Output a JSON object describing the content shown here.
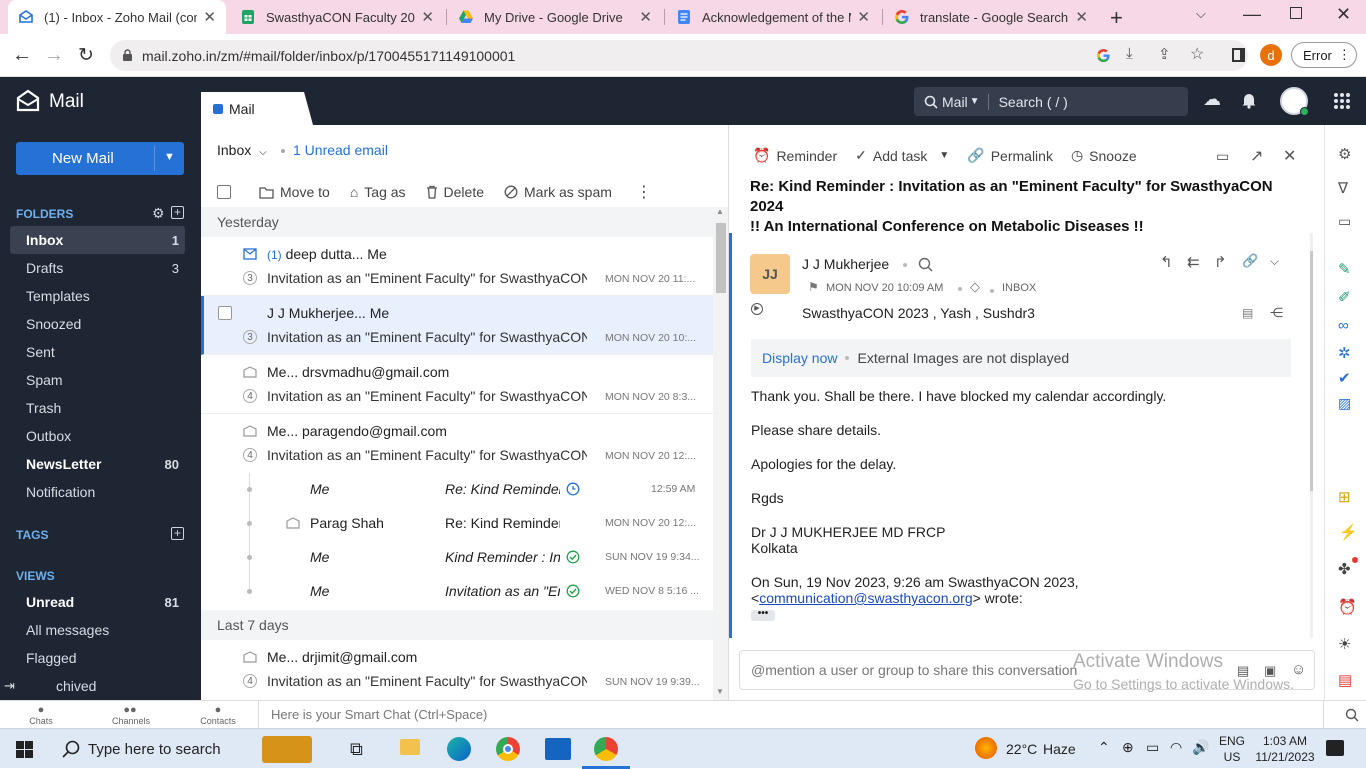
{
  "browser": {
    "tabs": [
      {
        "title": "(1) - Inbox - Zoho Mail (com",
        "active": true,
        "icon": "zoho-mail-icon"
      },
      {
        "title": "SwasthyaCON Faculty 2024",
        "active": false,
        "icon": "sheets-icon"
      },
      {
        "title": "My Drive - Google Drive",
        "active": false,
        "icon": "drive-icon"
      },
      {
        "title": "Acknowledgement of the M",
        "active": false,
        "icon": "docs-icon"
      },
      {
        "title": "translate - Google Search",
        "active": false,
        "icon": "google-icon"
      }
    ],
    "url": "mail.zoho.in/zm/#mail/folder/inbox/p/1700455171149100001",
    "profile_letter": "d",
    "error_label": "Error"
  },
  "app": {
    "name": "Mail",
    "tab_label": "Mail",
    "search_scope": "Mail",
    "search_placeholder": "Search ( / )"
  },
  "sidebar": {
    "new_mail": "New Mail",
    "folders_heading": "FOLDERS",
    "folders": [
      {
        "label": "Inbox",
        "count": "1",
        "active": true
      },
      {
        "label": "Drafts",
        "count": "3"
      },
      {
        "label": "Templates",
        "count": ""
      },
      {
        "label": "Snoozed",
        "count": ""
      },
      {
        "label": "Sent",
        "count": ""
      },
      {
        "label": "Spam",
        "count": ""
      },
      {
        "label": "Trash",
        "count": ""
      },
      {
        "label": "Outbox",
        "count": ""
      },
      {
        "label": "NewsLetter",
        "count": "80",
        "bold": true
      },
      {
        "label": "Notification",
        "count": ""
      }
    ],
    "tags_heading": "TAGS",
    "views_heading": "VIEWS",
    "views": [
      {
        "label": "Unread",
        "count": "81",
        "bold": true
      },
      {
        "label": "All messages",
        "count": ""
      },
      {
        "label": "Flagged",
        "count": ""
      },
      {
        "label": "chived",
        "count": ""
      }
    ]
  },
  "list": {
    "folder": "Inbox",
    "unread": "1 Unread email",
    "toolbar": {
      "move": "Move to",
      "tag": "Tag as",
      "delete": "Delete",
      "spam": "Mark as spam"
    },
    "group_yesterday": "Yesterday",
    "group_last7": "Last 7 days",
    "rows": [
      {
        "prefix": "(1)",
        "from": "deep dutta... Me",
        "count": "3",
        "subject": "Invitation as an \"Eminent Faculty\" for SwasthyaCON 2024",
        "date": "MON NOV 20 11:..."
      },
      {
        "prefix": "",
        "from": "J J Mukherjee... Me",
        "count": "3",
        "subject": "Invitation as an \"Eminent Faculty\" for SwasthyaCON 2024",
        "date": "MON NOV 20 10:..."
      },
      {
        "prefix": "",
        "from": "Me... drsvmadhu@gmail.com",
        "count": "4",
        "subject": "Invitation as an \"Eminent Faculty\" for SwasthyaCON 2024",
        "date": "MON NOV 20 8:3..."
      },
      {
        "prefix": "",
        "from": "Me... paragendo@gmail.com",
        "count": "4",
        "subject": "Invitation as an \"Eminent Faculty\" for SwasthyaCON 2024",
        "date": "MON NOV 20 12:..."
      }
    ],
    "thread": [
      {
        "from": "Me",
        "subject": "Re: Kind Reminder : Invitation",
        "date": "12:59 AM",
        "status": "clock"
      },
      {
        "from": "Parag Shah",
        "subject": "Re: Kind Reminder : Invitation",
        "date": "MON NOV 20 12:...",
        "status": ""
      },
      {
        "from": "Me",
        "subject": "Kind Reminder : Invitation",
        "date": "SUN NOV 19 9:34...",
        "status": "check"
      },
      {
        "from": "Me",
        "subject": "Invitation as an \"Eminent",
        "date": "WED NOV 8 5:16 ...",
        "status": "check"
      }
    ],
    "last_row": {
      "from": "Me... drjimit@gmail.com",
      "count": "4",
      "subject": "Invitation as an \"Eminent Faculty\" for SwasthyaCON 2024",
      "date": "SUN NOV 19 9:39..."
    }
  },
  "reader": {
    "toolbar": {
      "reminder": "Reminder",
      "add_task": "Add task",
      "permalink": "Permalink",
      "snooze": "Snooze"
    },
    "subject_line1": "Re: Kind Reminder : Invitation as an \"Eminent Faculty\" for SwasthyaCON 2024",
    "subject_line2": "!! An International Conference on Metabolic Diseases !!",
    "avatar": "JJ",
    "sender": "J J Mukherjee",
    "date": "MON NOV 20 10:09 AM",
    "folder": "INBOX",
    "recipients": "SwasthyaCON 2023 , Yash , Sushdr3",
    "display_now": "Display now",
    "images_note": "External Images are not displayed",
    "body": [
      "Thank you. Shall be there. I have blocked my calendar accordingly.",
      "Please share details.",
      "Apologies for the delay.",
      "Rgds"
    ],
    "sig_name": "Dr J J MUKHERJEE MD FRCP",
    "sig_city": "Kolkata",
    "quote_line1": "On Sun, 19 Nov 2023, 9:26 am SwasthyaCON 2023,",
    "quote_lt": "<",
    "quote_email": "communication@swasthyacon.org",
    "quote_tail": "> wrote:",
    "comment_placeholder": "@mention a user or group to share this conversation"
  },
  "watermark": {
    "line1": "Activate Windows",
    "line2": "Go to Settings to activate Windows."
  },
  "bottom": {
    "chats": "Chats",
    "channels": "Channels",
    "contacts": "Contacts",
    "smartchat": "Here is your Smart Chat (Ctrl+Space)"
  },
  "taskbar": {
    "search": "Type here to search",
    "temp": "22°C",
    "weather": "Haze",
    "lang1": "ENG",
    "lang2": "US",
    "time": "1:03 AM",
    "date": "11/21/2023"
  },
  "colors": {
    "accent": "#2571d5",
    "sidebar": "#1e2533",
    "selected_row": "#e8f0fe",
    "tabbar": "#f7d8e6"
  }
}
